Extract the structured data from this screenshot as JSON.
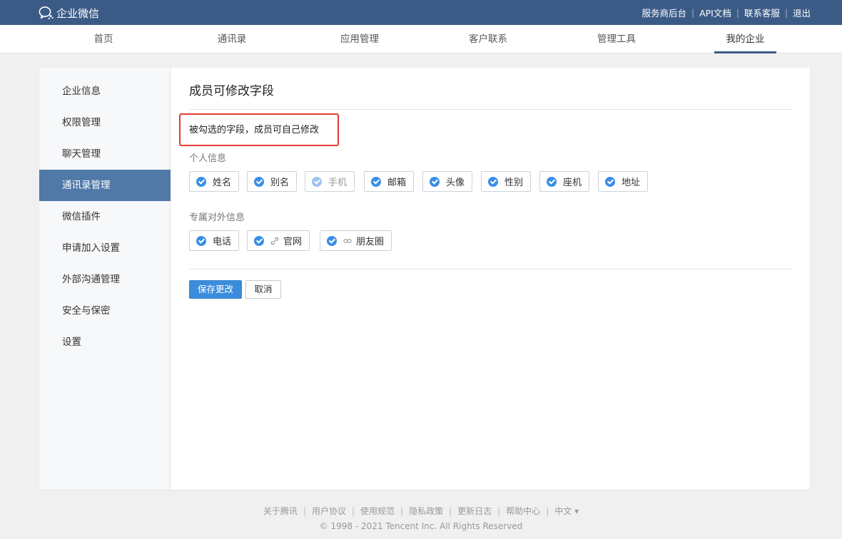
{
  "header": {
    "brand": "企业微信",
    "links": [
      "服务商后台",
      "API文档",
      "联系客服",
      "退出"
    ]
  },
  "nav": {
    "items": [
      "首页",
      "通讯录",
      "应用管理",
      "客户联系",
      "管理工具",
      "我的企业"
    ],
    "active": "我的企业"
  },
  "sidebar": {
    "items": [
      "企业信息",
      "权限管理",
      "聊天管理",
      "通讯录管理",
      "微信插件",
      "申请加入设置",
      "外部沟通管理",
      "安全与保密",
      "设置"
    ],
    "active": "通讯录管理"
  },
  "main": {
    "title": "成员可修改字段",
    "hint": "被勾选的字段，成员可自己修改",
    "personal": {
      "label": "个人信息",
      "fields": [
        "姓名",
        "别名",
        "手机",
        "邮箱",
        "头像",
        "性别",
        "座机",
        "地址"
      ]
    },
    "external": {
      "label": "专属对外信息",
      "fields": [
        "电话",
        "官网",
        "朋友圈"
      ]
    },
    "save_label": "保存更改",
    "cancel_label": "取消"
  },
  "footer": {
    "links": [
      "关于腾讯",
      "用户协议",
      "使用规范",
      "隐私政策",
      "更新日志",
      "帮助中心"
    ],
    "language": "中文 ▾",
    "copyright": "© 1998 - 2021 Tencent Inc. All Rights Reserved"
  },
  "colors": {
    "header_bg": "#3b5b87",
    "accent": "#3a8ee6",
    "sidebar_active": "#5079a8",
    "highlight": "#e43c33"
  },
  "icons": {
    "brand": "wecom-logo-icon",
    "check": "check-circle-icon",
    "link": "link-icon"
  }
}
